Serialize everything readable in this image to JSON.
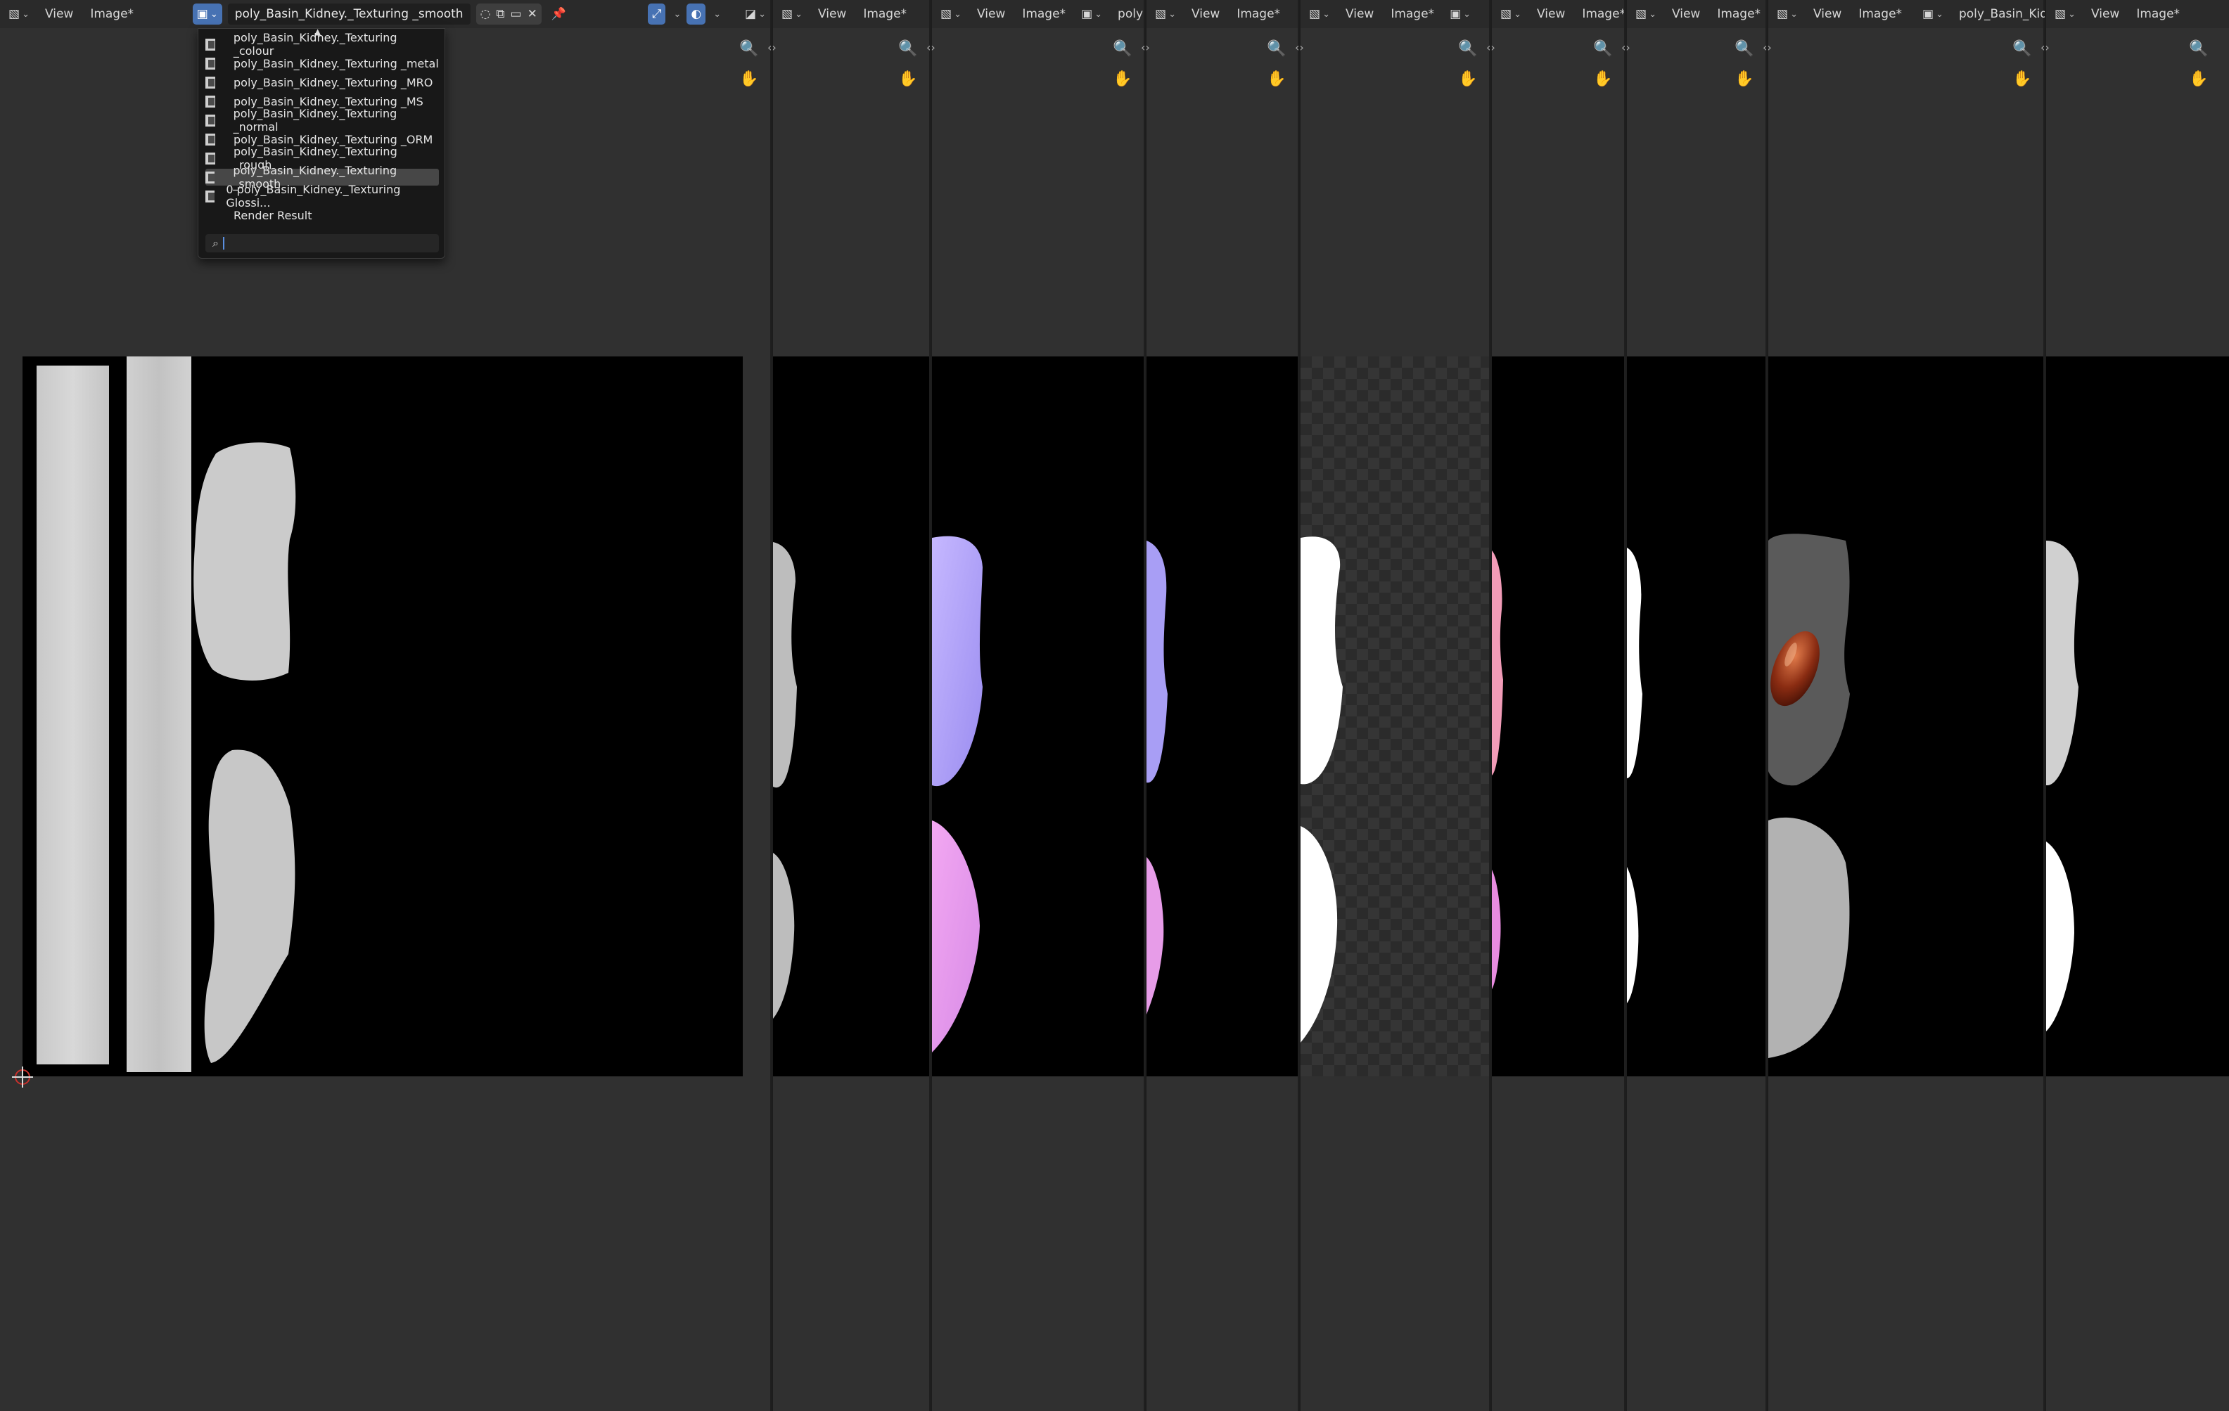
{
  "panel1": {
    "view_menu": "View",
    "image_menu": "Image*",
    "image_name": "poly_Basin_Kidney._Texturing _smooth",
    "dropdown": {
      "items": [
        "poly_Basin_Kidney._Texturing _colour",
        "poly_Basin_Kidney._Texturing _metal",
        "poly_Basin_Kidney._Texturing _MRO",
        "poly_Basin_Kidney._Texturing _MS",
        "poly_Basin_Kidney._Texturing _normal",
        "poly_Basin_Kidney._Texturing _ORM",
        "poly_Basin_Kidney._Texturing _rough",
        "poly_Basin_Kidney._Texturing _smooth",
        "0 poly_Basin_Kidney._Texturing Glossi...",
        "Render Result"
      ],
      "highlighted_index": 7,
      "search_placeholder": ""
    }
  },
  "panel2": {
    "view_menu": "View",
    "image_menu": "Image*"
  },
  "panel3": {
    "view_menu": "View",
    "image_menu": "Image*",
    "image_name_partial": "poly"
  },
  "panel4": {
    "view_menu": "View",
    "image_menu": "Image*"
  },
  "panel5": {
    "view_menu": "View",
    "image_menu": "Image*"
  },
  "panel6": {
    "view_menu": "View",
    "image_menu": "Image*"
  },
  "panel7": {
    "view_menu": "View",
    "image_menu": "Image*"
  },
  "panel8": {
    "view_menu": "View",
    "image_menu": "Image*"
  },
  "panel9": {
    "image_name_partial": "poly_Basin_Kidr"
  },
  "panel10": {
    "view_menu": "View",
    "image_menu": "Image*"
  },
  "icons": {
    "editor_type": "image-editor-icon",
    "zoom": "magnifier-icon",
    "pan": "hand-icon",
    "browse": "image-browse-icon",
    "pin": "pin-icon",
    "gizmo": "cursor-icon",
    "overlay": "overlay-icon"
  },
  "colors": {
    "background": "#303030",
    "header": "#2a2a2a",
    "canvas": "#000000",
    "accent": "#4772b3"
  }
}
